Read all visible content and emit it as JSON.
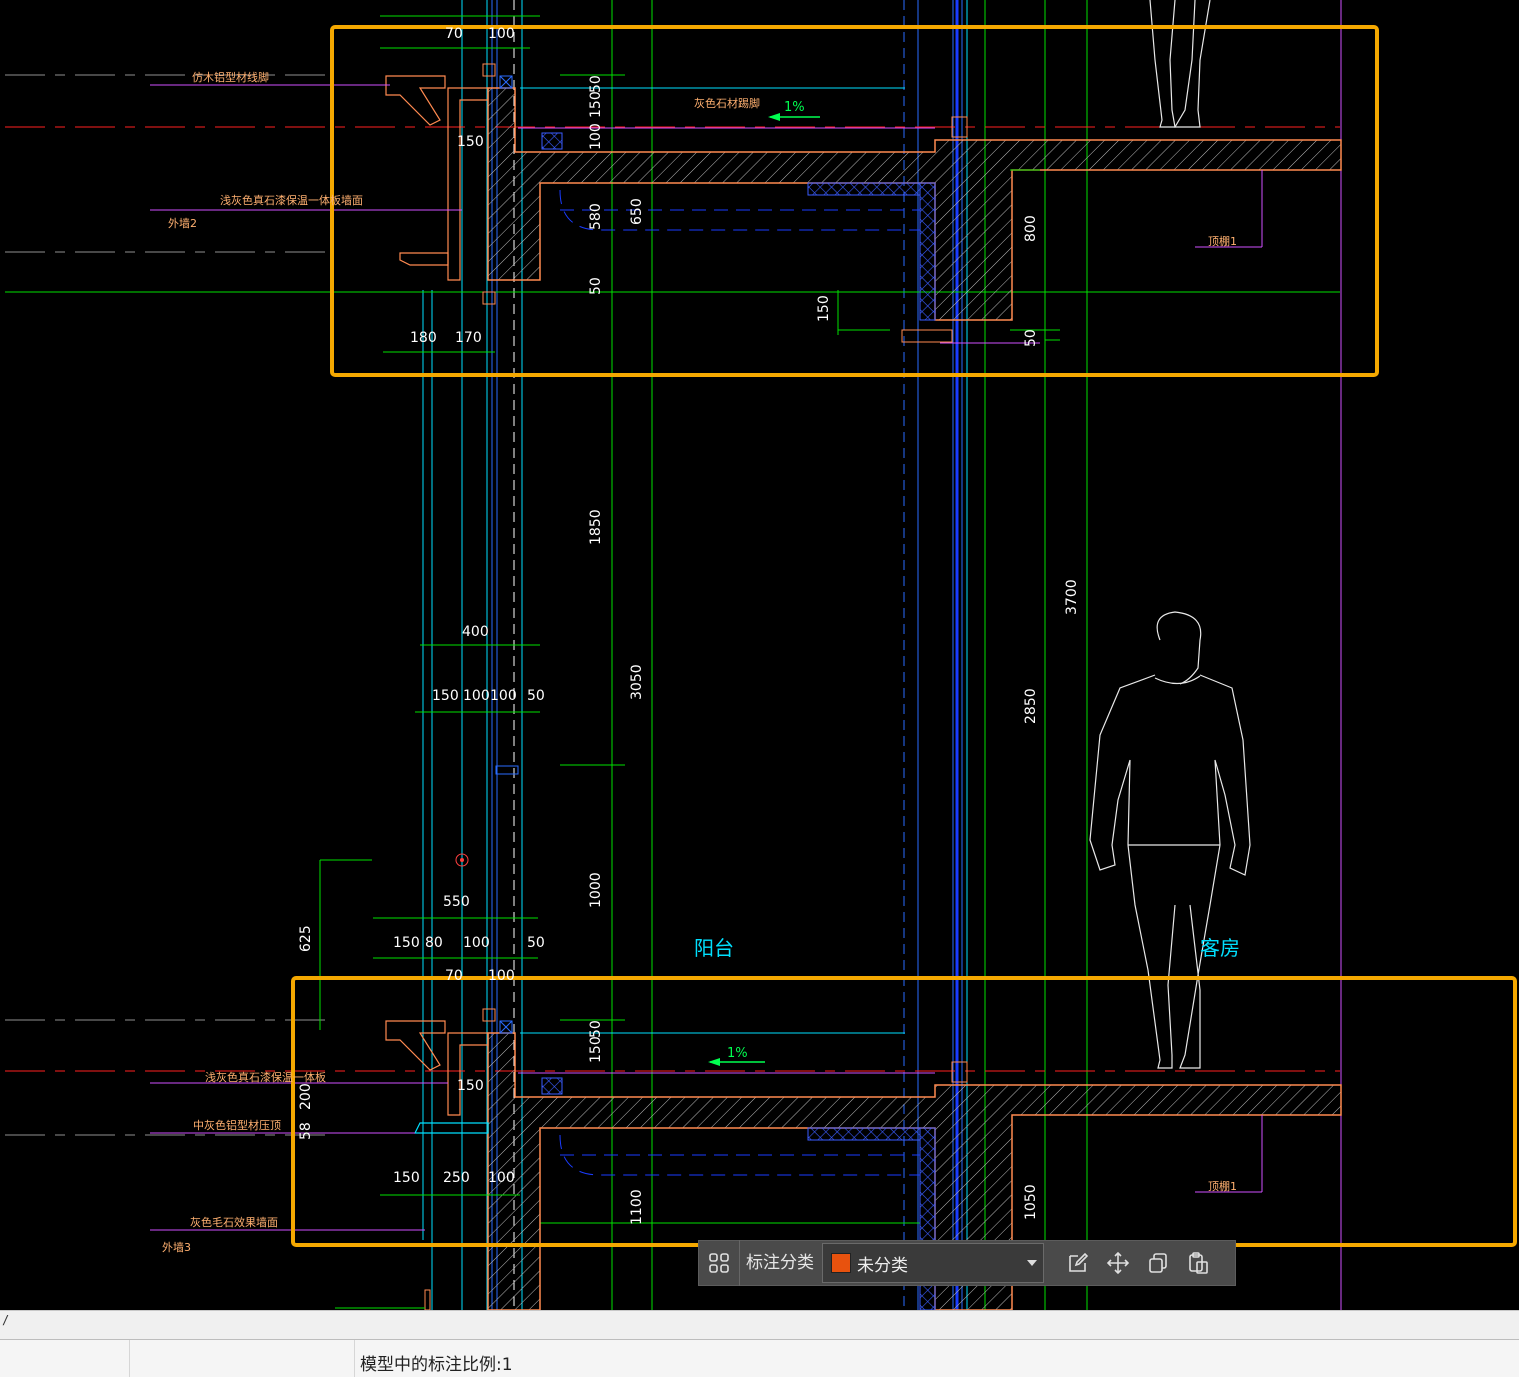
{
  "drawing": {
    "dims_top": {
      "d70a": "70",
      "d100a": "100",
      "d50a": "50",
      "d150a": "150",
      "d100b": "100",
      "d150b": "150",
      "d650": "650",
      "d580": "580",
      "d50b": "50",
      "d800": "800",
      "d150c": "150",
      "d50c": "50",
      "d180": "180",
      "d170": "170",
      "slope1": "1%"
    },
    "dims_mid": {
      "d1850": "1850",
      "d3700": "3700",
      "d400": "400",
      "d150": "150",
      "d100a": "100",
      "d100b": "100",
      "d50": "50",
      "d3050": "3050",
      "d2850": "2850",
      "d1000": "1000",
      "d625": "625",
      "d550": "550",
      "d150b": "150",
      "d80": "80",
      "d100c": "100",
      "d50b": "50",
      "d70": "70",
      "d100d": "100"
    },
    "dims_bottom": {
      "d50a": "50",
      "d150a": "150",
      "d150b": "150",
      "d200": "200",
      "d58": "58",
      "d150c": "150",
      "d250": "250",
      "d100": "100",
      "d1100": "1100",
      "d1050": "1050",
      "slope2": "1%"
    },
    "labels": {
      "top_baseboard": "仿木铝型材线脚",
      "stone_baseboard": "灰色石材踢脚",
      "paint_wall_top": "浅灰色真石漆保温一体板墙面",
      "wall2": "外墙2",
      "ceiling1": "顶棚1",
      "balcony": "阳台",
      "guest_room": "客房",
      "paint_wall_bottom": "浅灰色真石漆保温一体板",
      "alu_cap": "中灰色铝型材压顶",
      "gray_stone_wall": "灰色毛石效果墙面",
      "wall3": "外墙3",
      "ceiling1b": "顶棚1"
    }
  },
  "toolbar": {
    "label": "标注分类",
    "selected": "未分类",
    "swatch_color": "#e8520e"
  },
  "command": {
    "prompt": "/"
  },
  "status": {
    "scale_text": "模型中的标注比例:1"
  },
  "colors": {
    "highlight": "#f5a800",
    "dim": "#00e000",
    "wall": "#ff8a50",
    "glass": "#1a3cff"
  }
}
